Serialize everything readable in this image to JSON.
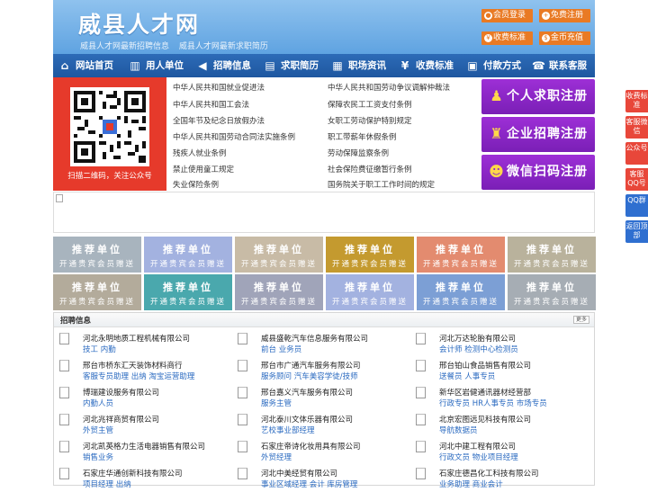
{
  "header": {
    "title": "威县人才网",
    "subtitles": [
      "威县人才网最新招聘信息",
      "威县人才网最新求职简历"
    ],
    "buttons": [
      {
        "label": "会员登录",
        "icon": "user-icon"
      },
      {
        "label": "免费注册",
        "icon": "plus-icon"
      },
      {
        "label": "收费标准",
        "icon": "yen-icon"
      },
      {
        "label": "金币充值",
        "icon": "coin-icon"
      }
    ]
  },
  "nav": [
    {
      "label": "网站首页",
      "icon": "home-icon"
    },
    {
      "label": "用人单位",
      "icon": "building-icon"
    },
    {
      "label": "招聘信息",
      "icon": "megaphone-icon"
    },
    {
      "label": "求职简历",
      "icon": "resume-icon"
    },
    {
      "label": "职场资讯",
      "icon": "news-icon"
    },
    {
      "label": "收费标准",
      "icon": "yen-icon"
    },
    {
      "label": "付款方式",
      "icon": "wallet-icon"
    },
    {
      "label": "联系客服",
      "icon": "phone-icon"
    }
  ],
  "qr": {
    "caption": "扫描二维码，关注公众号"
  },
  "law_links": [
    [
      "中华人民共和国就业促进法",
      "中华人民共和国劳动争议调解仲裁法"
    ],
    [
      "中华人民共和国工会法",
      "保障农民工工资支付条例"
    ],
    [
      "全国年节及纪念日放假办法",
      "女职工劳动保护特别规定"
    ],
    [
      "中华人民共和国劳动合同法实施条例",
      "职工带薪年休假条例"
    ],
    [
      "残疾人就业条例",
      "劳动保障监察条例"
    ],
    [
      "禁止使用童工规定",
      "社会保险费征缴暂行条例"
    ],
    [
      "失业保险条例",
      "国务院关于职工工作时间的规定"
    ]
  ],
  "reg_buttons": [
    {
      "label": "个人求职注册",
      "icon": "person-icon"
    },
    {
      "label": "企业招聘注册",
      "icon": "company-icon"
    },
    {
      "label": "微信扫码注册",
      "icon": "wechat-icon"
    }
  ],
  "recommend": {
    "title": "推荐单位",
    "subtitle": "开通贵宾会员赠送",
    "colors": [
      "#a8b4be",
      "#a3b2e0",
      "#c8bba6",
      "#c49a2f",
      "#e38b6f",
      "#b9b29c",
      "#b3ab9b",
      "#4aa8ad",
      "#a0a4b9",
      "#a3b2e0",
      "#7c9fd5",
      "#a6adb4"
    ]
  },
  "jobs": {
    "title": "招聘信息",
    "more": "更多",
    "items": [
      {
        "company": "河北永明地质工程机械有限公司",
        "positions": "技工 内勤"
      },
      {
        "company": "威县盛乾汽车信息服务有限公司",
        "positions": "前台 业务员"
      },
      {
        "company": "河北万达轮胎有限公司",
        "positions": "会计师 检测中心检测员"
      },
      {
        "company": "邢台市桥东汇天装饰材料商行",
        "positions": "客服专员助理 出纳 淘宝运营助理"
      },
      {
        "company": "邢台市广通汽车服务有限公司",
        "positions": "服务顾问 汽车美容学徒/技师"
      },
      {
        "company": "邢台铂山食品销售有限公司",
        "positions": "送餐员 人事专员"
      },
      {
        "company": "博瑞建设服务有限公司",
        "positions": "内勤人员"
      },
      {
        "company": "邢台嘉义汽车服务有限公司",
        "positions": "服务主管"
      },
      {
        "company": "新华区岩健通讯器材经营部",
        "positions": "行政专员 HR人事专员 市场专员"
      },
      {
        "company": "河北兆祥商贸有限公司",
        "positions": "外贸主管"
      },
      {
        "company": "河北泰川文体乐器有限公司",
        "positions": "艺校事业部经理"
      },
      {
        "company": "北京宏图远见科技有限公司",
        "positions": "导航数据员"
      },
      {
        "company": "河北凯英格力生活电器销售有限公司",
        "positions": "销售业务"
      },
      {
        "company": "石家庄帝诗化妆用具有限公司",
        "positions": "外贸经理"
      },
      {
        "company": "河北中建工程有限公司",
        "positions": "行政文员 物业项目经理"
      },
      {
        "company": "石家庄华通创新科技有限公司",
        "positions": "项目经理 出纳"
      },
      {
        "company": "河北中美经贸有限公司",
        "positions": "事业区域经理 会计 库房管理"
      },
      {
        "company": "石家庄德昌化工科技有限公司",
        "positions": "业务助理 商业会计"
      }
    ]
  },
  "side": [
    "收费标准",
    "客服微信",
    "公众号",
    "客服QQ号",
    "QQ群",
    "返回顶部"
  ]
}
